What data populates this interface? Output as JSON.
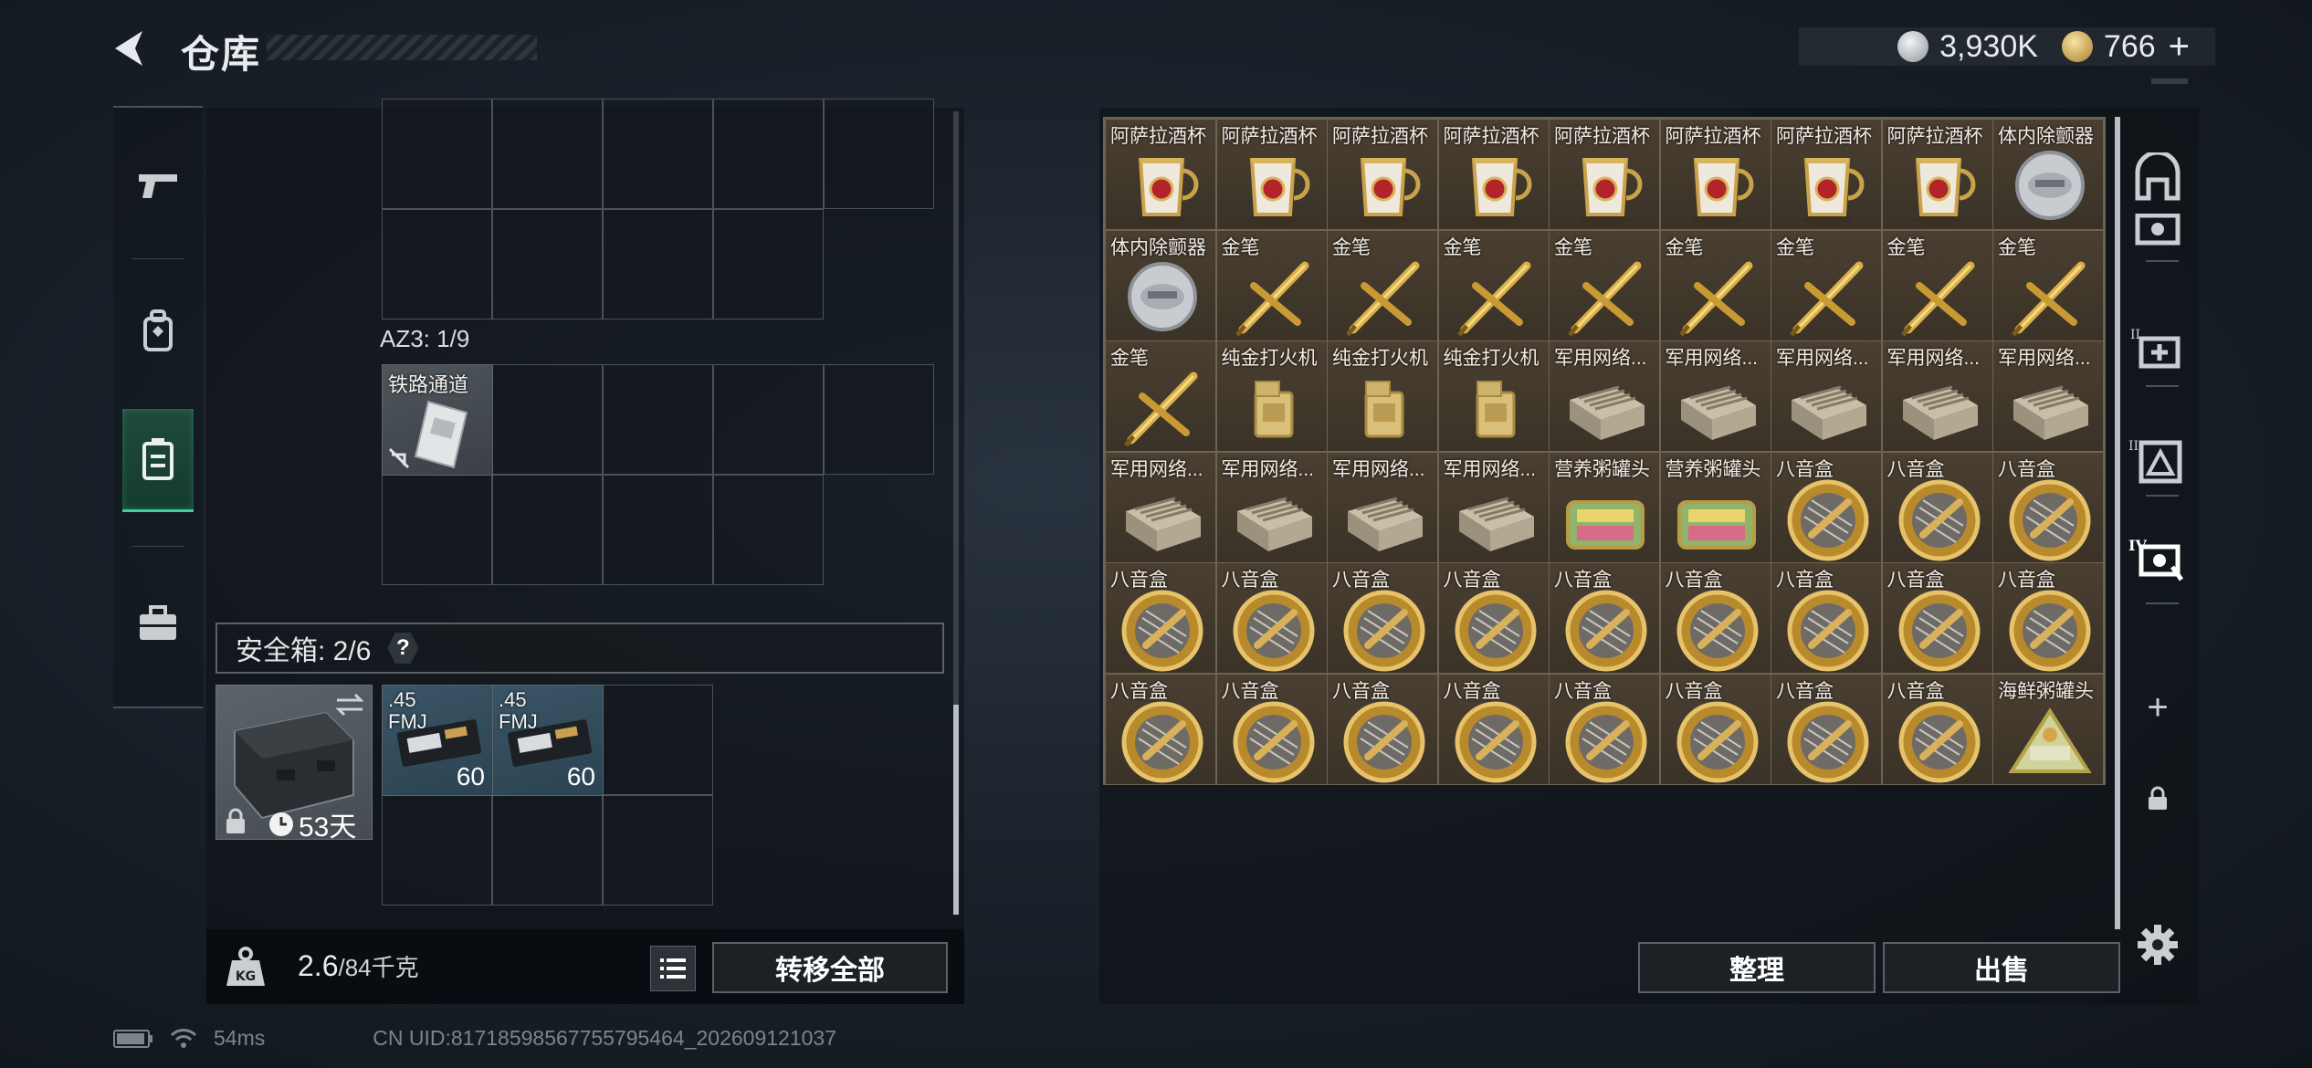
{
  "header": {
    "title": "仓库",
    "currency_silver": "3,930K",
    "currency_gold": "766",
    "currency_plus": "+"
  },
  "left_tabs": [
    "pistol-tab",
    "backpack-tab",
    "safe-box-tab",
    "toolbox-tab"
  ],
  "container": {
    "az3_label": "AZ3: 1/9",
    "az3_item": "铁路通道",
    "safe_label": "安全箱: 2/6",
    "safe_help": "?",
    "safe_days": "53天",
    "ammo": [
      {
        "name_line1": ".45",
        "name_line2": "FMJ",
        "count": "60"
      },
      {
        "name_line1": ".45",
        "name_line2": "FMJ",
        "count": "60"
      }
    ]
  },
  "bottom_left": {
    "weight_current": "2.6",
    "weight_max": "/84千克",
    "transfer_all": "转移全部"
  },
  "stash": {
    "items": [
      "阿萨拉酒杯",
      "阿萨拉酒杯",
      "阿萨拉酒杯",
      "阿萨拉酒杯",
      "阿萨拉酒杯",
      "阿萨拉酒杯",
      "阿萨拉酒杯",
      "阿萨拉酒杯",
      "体内除颤器",
      "体内除颤器",
      "金笔",
      "金笔",
      "金笔",
      "金笔",
      "金笔",
      "金笔",
      "金笔",
      "金笔",
      "金笔",
      "纯金打火机",
      "纯金打火机",
      "纯金打火机",
      "军用网络...",
      "军用网络...",
      "军用网络...",
      "军用网络...",
      "军用网络...",
      "军用网络...",
      "军用网络...",
      "军用网络...",
      "军用网络...",
      "营养粥罐头",
      "营养粥罐头",
      "八音盒",
      "八音盒",
      "八音盒",
      "八音盒",
      "八音盒",
      "八音盒",
      "八音盒",
      "八音盒",
      "八音盒",
      "八音盒",
      "八音盒",
      "八音盒",
      "八音盒",
      "八音盒",
      "八音盒",
      "八音盒",
      "八音盒",
      "八音盒",
      "八音盒",
      "八音盒",
      "海鲜粥罐头"
    ],
    "types": [
      "cup",
      "cup",
      "cup",
      "cup",
      "cup",
      "cup",
      "cup",
      "cup",
      "defib",
      "defib",
      "pen",
      "pen",
      "pen",
      "pen",
      "pen",
      "pen",
      "pen",
      "pen",
      "pen",
      "lighter",
      "lighter",
      "lighter",
      "router",
      "router",
      "router",
      "router",
      "router",
      "router",
      "router",
      "router",
      "router",
      "tin",
      "tin",
      "musicbox",
      "musicbox",
      "musicbox",
      "musicbox",
      "musicbox",
      "musicbox",
      "musicbox",
      "musicbox",
      "musicbox",
      "musicbox",
      "musicbox",
      "musicbox",
      "musicbox",
      "musicbox",
      "musicbox",
      "musicbox",
      "musicbox",
      "musicbox",
      "musicbox",
      "musicbox",
      "seafood"
    ],
    "sort_label": "整理",
    "sell_label": "出售"
  },
  "right_tabs": {
    "tab_labels": [
      "II",
      "III",
      "IV"
    ],
    "add": "+"
  },
  "status_bar": {
    "ping": "54ms",
    "uid": "CN UID:817185985677557954​64_202609121037"
  }
}
